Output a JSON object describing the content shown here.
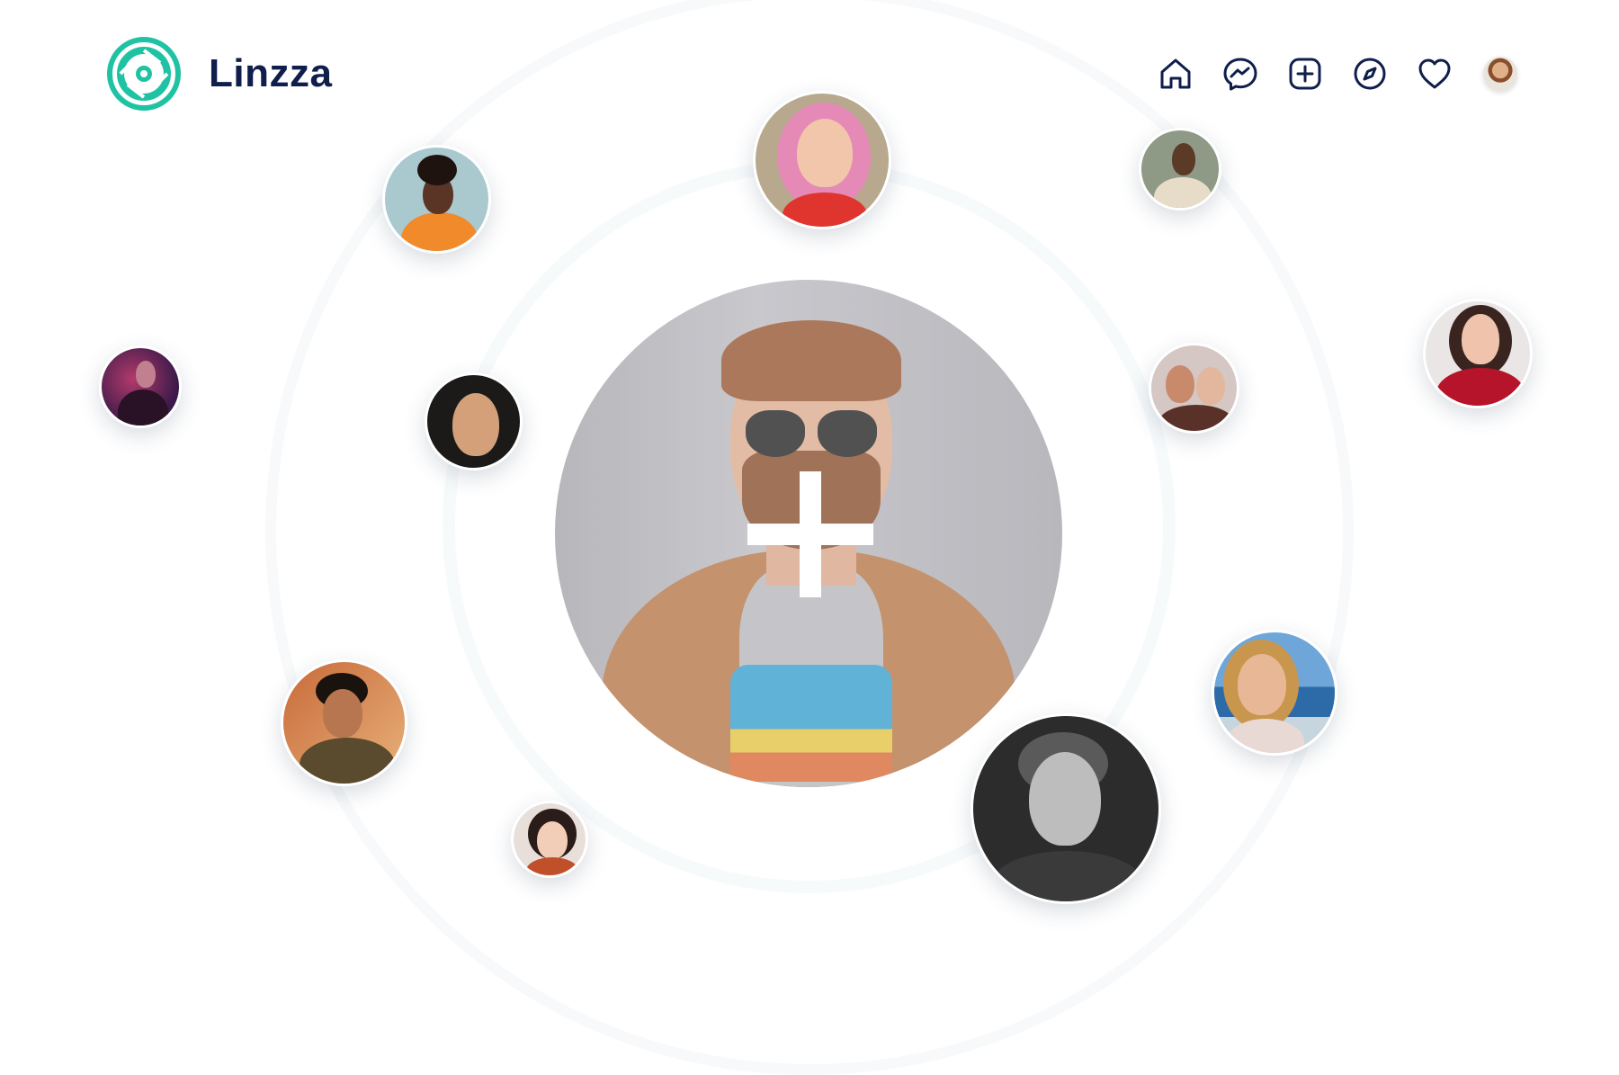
{
  "brand": {
    "name": "Linzza",
    "accent_color": "#1fc3a3",
    "text_color": "#0f1e4b"
  },
  "nav": {
    "items": [
      {
        "icon": "home-icon"
      },
      {
        "icon": "messenger-icon"
      },
      {
        "icon": "add-post-icon"
      },
      {
        "icon": "explore-compass-icon"
      },
      {
        "icon": "heart-icon"
      }
    ],
    "profile_icon": "profile-avatar"
  },
  "main_photo": {
    "action_icon": "plus-icon"
  },
  "avatars": [
    {
      "name": "avatar-woman-orange-jacket"
    },
    {
      "name": "avatar-woman-pink-hair-glasses"
    },
    {
      "name": "avatar-man-beige-coat"
    },
    {
      "name": "avatar-woman-purple-light"
    },
    {
      "name": "avatar-woman-smiling-dark-hair"
    },
    {
      "name": "avatar-two-women"
    },
    {
      "name": "avatar-woman-red-sweater"
    },
    {
      "name": "avatar-man-patterned-shirt"
    },
    {
      "name": "avatar-woman-short-hair"
    },
    {
      "name": "avatar-man-black-white"
    },
    {
      "name": "avatar-woman-blonde-sea"
    }
  ]
}
